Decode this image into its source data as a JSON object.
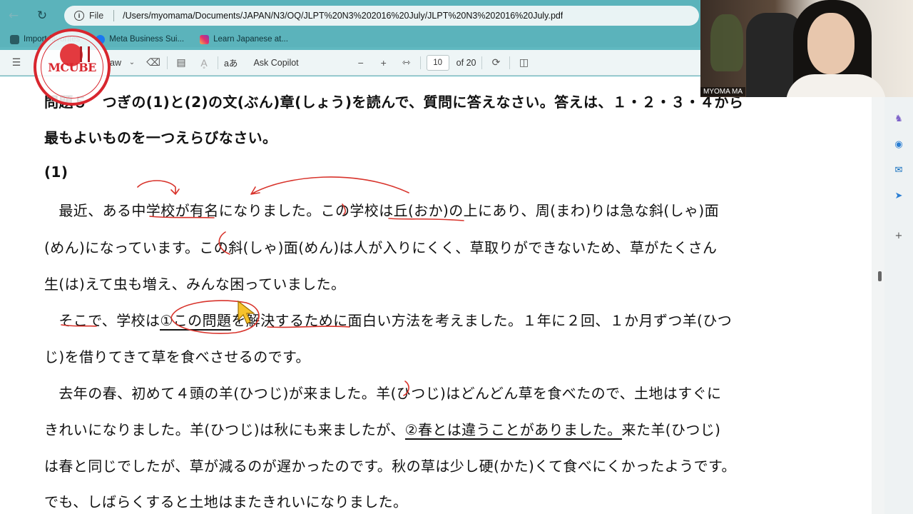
{
  "browser": {
    "file_label": "File",
    "url": "/Users/myomama/Documents/JAPAN/N3/OQ/JLPT%20N3%202016%20July/JLPT%20N3%202016%20July.pdf",
    "bookmarks": [
      {
        "label": "Import favorites",
        "icon": "folder-icon"
      },
      {
        "label": "Meta Business Sui...",
        "icon": "meta-icon"
      },
      {
        "label": "Learn Japanese at...",
        "icon": "instagram-icon"
      }
    ]
  },
  "pdf_toolbar": {
    "draw_label": "aw",
    "read_aloud_label": "aあ",
    "copilot_label": "Ask Copilot",
    "page_number": "10",
    "page_total": "of 20"
  },
  "logo": {
    "text": "MCUBE"
  },
  "webcam": {
    "name": "MYOMA MA"
  },
  "document": {
    "heading_line1": "問題５　つぎの(1)と(2)の文(ぶん)章(しょう)を読んで、質問に答えなさい。答えは、１・２・３・４から",
    "heading_line2": "最もよいものを一つえらびなさい。",
    "section_label": "(1)",
    "p1_line1": "　最近、ある中学校が有名になりました。この学校は丘(おか)の上にあり、周(まわ)りは急な斜(しゃ)面",
    "p1_line2": "(めん)になっています。この斜(しゃ)面(めん)は人が入りにくく、草取りができないため、草がたくさん",
    "p1_line3": "生(は)えて虫も増え、みんな困っていました。",
    "p2_prefix": "　そこで、学校は",
    "p2_underlined": "①この問題",
    "p2_rest": "を解決するために面白い方法を考えました。１年に２回、１か月ずつ羊(ひつ",
    "p2_line2": "じ)を借りてきて草を食べさせるのです。",
    "p3_line1": "　去年の春、初めて４頭の羊(ひつじ)が来ました。羊(ひつじ)はどんどん草を食べたので、土地はすぐに",
    "p3_line2_prefix": "きれいになりました。羊(ひつじ)は秋にも来ましたが、",
    "p3_line2_underlined": "②春とは違うことがありました。",
    "p3_line2_rest": "来た羊(ひつじ)",
    "p3_line3": "は春と同じでしたが、草が減るのが遅かったのです。秋の草は少し硬(かた)くて食べにくかったようです。",
    "p3_line4": "でも、しばらくすると土地はまたきれいになりました。"
  },
  "colors": {
    "annotation": "#d8332b",
    "browser_chrome": "#5bb3bb",
    "logo_red": "#d8262e"
  }
}
